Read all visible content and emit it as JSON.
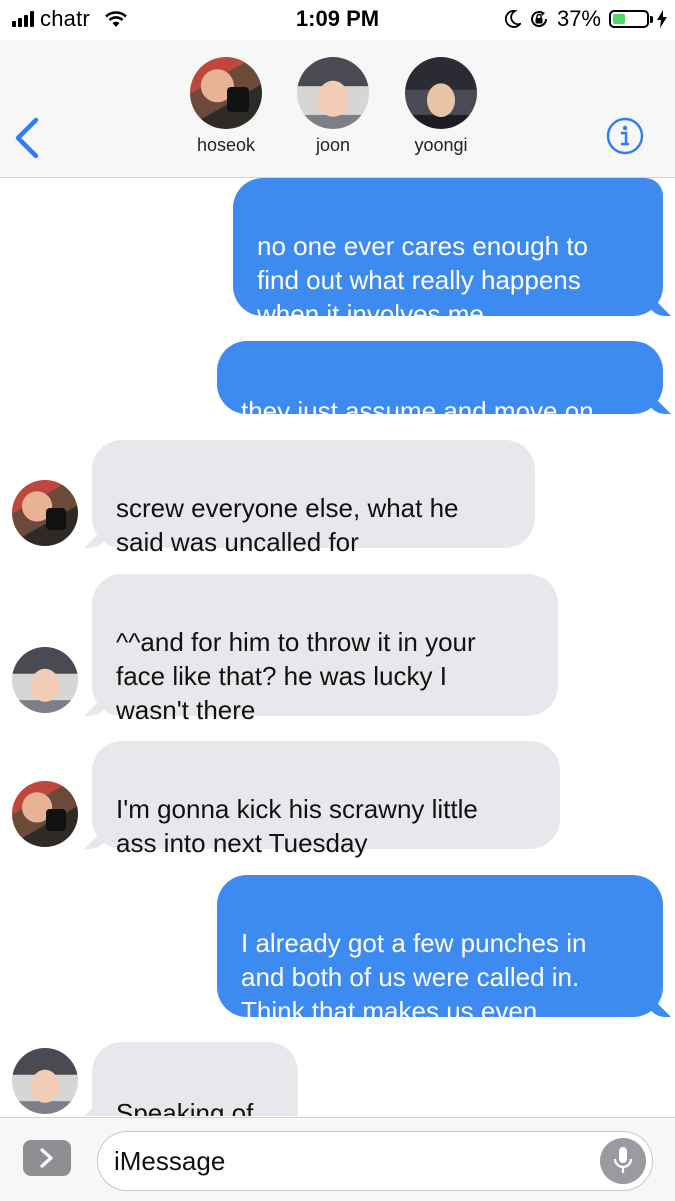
{
  "status_bar": {
    "carrier": "chatr",
    "time": "1:09 PM",
    "battery_percent_text": "37%",
    "battery_level": 0.37,
    "icons": [
      "signal-icon",
      "wifi-icon",
      "do-not-disturb-icon",
      "orientation-lock-icon",
      "battery-icon",
      "charging-icon"
    ],
    "battery_color": "#4cd964"
  },
  "header": {
    "back_icon": "chevron-left-icon",
    "info_icon": "info-icon",
    "accent_color": "#2f7cf6",
    "participants": [
      {
        "name": "hoseok"
      },
      {
        "name": "joon"
      },
      {
        "name": "yoongi"
      }
    ]
  },
  "messages": [
    {
      "direction": "outgoing",
      "sender": "",
      "text": "no one ever cares enough to\nfind out what really happens\nwhen it involves me"
    },
    {
      "direction": "outgoing",
      "sender": "",
      "text": "they just assume and move on"
    },
    {
      "direction": "incoming",
      "sender": "hoseok",
      "text": "screw everyone else, what he\nsaid was uncalled for"
    },
    {
      "direction": "incoming",
      "sender": "joon",
      "text": "^^and for him to throw it in your\nface like that? he was lucky I\nwasn't there"
    },
    {
      "direction": "incoming",
      "sender": "hoseok",
      "text": "I'm gonna kick his scrawny little\nass into next Tuesday"
    },
    {
      "direction": "outgoing",
      "sender": "",
      "text": "I already got a few punches in\nand both of us were called in.\nThink that makes us even"
    },
    {
      "direction": "incoming",
      "sender": "joon",
      "text": "Speaking of"
    }
  ],
  "colors": {
    "outgoing_bubble": "#3d8bf1",
    "incoming_bubble": "#e8e8ec"
  },
  "input_bar": {
    "apps_icon": "chevron-right-icon",
    "placeholder": "iMessage",
    "mic_icon": "microphone-icon"
  }
}
